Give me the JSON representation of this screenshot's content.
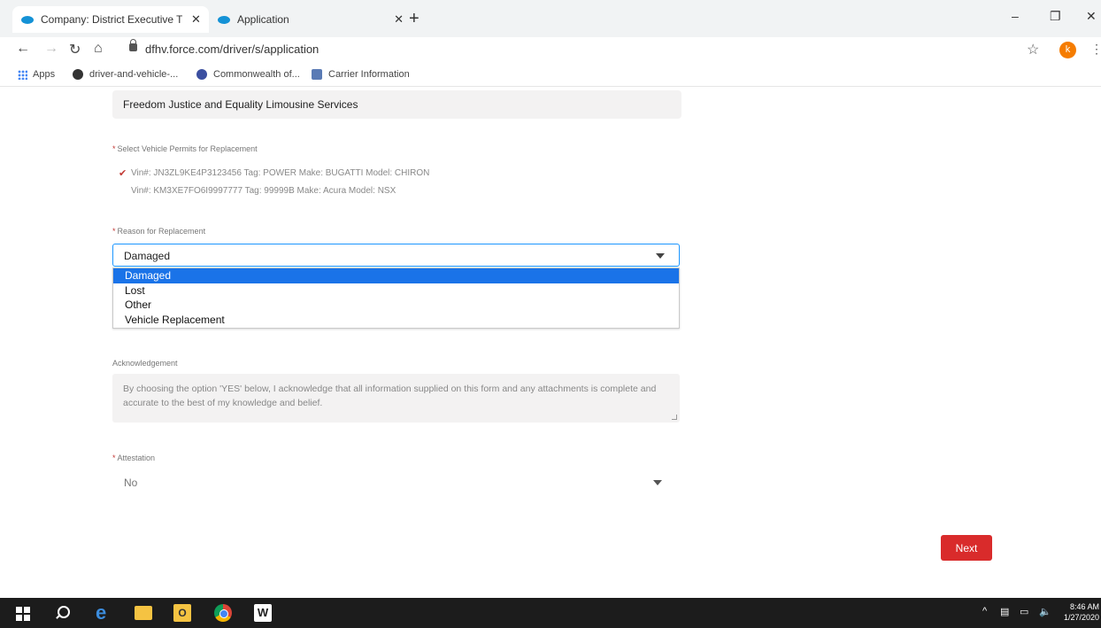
{
  "browser": {
    "tabs": [
      {
        "title": "Company: District Executive Tra",
        "active": true
      },
      {
        "title": "Application",
        "active": false
      }
    ],
    "url": "dfhv.force.com/driver/s/application",
    "profile_initial": "k",
    "bookmarks": [
      {
        "label": "Apps"
      },
      {
        "label": "driver-and-vehicle-..."
      },
      {
        "label": "Commonwealth of..."
      },
      {
        "label": "Carrier Information"
      }
    ]
  },
  "form": {
    "company_name": "Freedom Justice and Equality Limousine Services",
    "permits_label": "Select Vehicle Permits for Replacement",
    "permits": [
      {
        "text": "Vin#: JN3ZL9KE4P3123456 Tag: POWER Make: BUGATTI Model: CHIRON",
        "checked": true
      },
      {
        "text": "Vin#: KM3XE7FO6I9997777 Tag: 99999B Make: Acura Model: NSX",
        "checked": false
      }
    ],
    "reason_label": "Reason for Replacement",
    "reason_value": "Damaged",
    "reason_options": [
      "Damaged",
      "Lost",
      "Other",
      "Vehicle Replacement"
    ],
    "ack_label": "Acknowledgement",
    "ack_text": "By choosing the option 'YES' below, I acknowledge that all information supplied on this form and any attachments is complete and accurate to the best of my knowledge and belief.",
    "attestation_label": "Attestation",
    "attestation_value": "No",
    "next_label": "Next"
  },
  "taskbar": {
    "time": "8:46 AM",
    "date": "1/27/2020"
  },
  "colors": {
    "accent_blue": "#1a73e8",
    "next_red": "#d92b2b",
    "required_red": "#c23934"
  }
}
